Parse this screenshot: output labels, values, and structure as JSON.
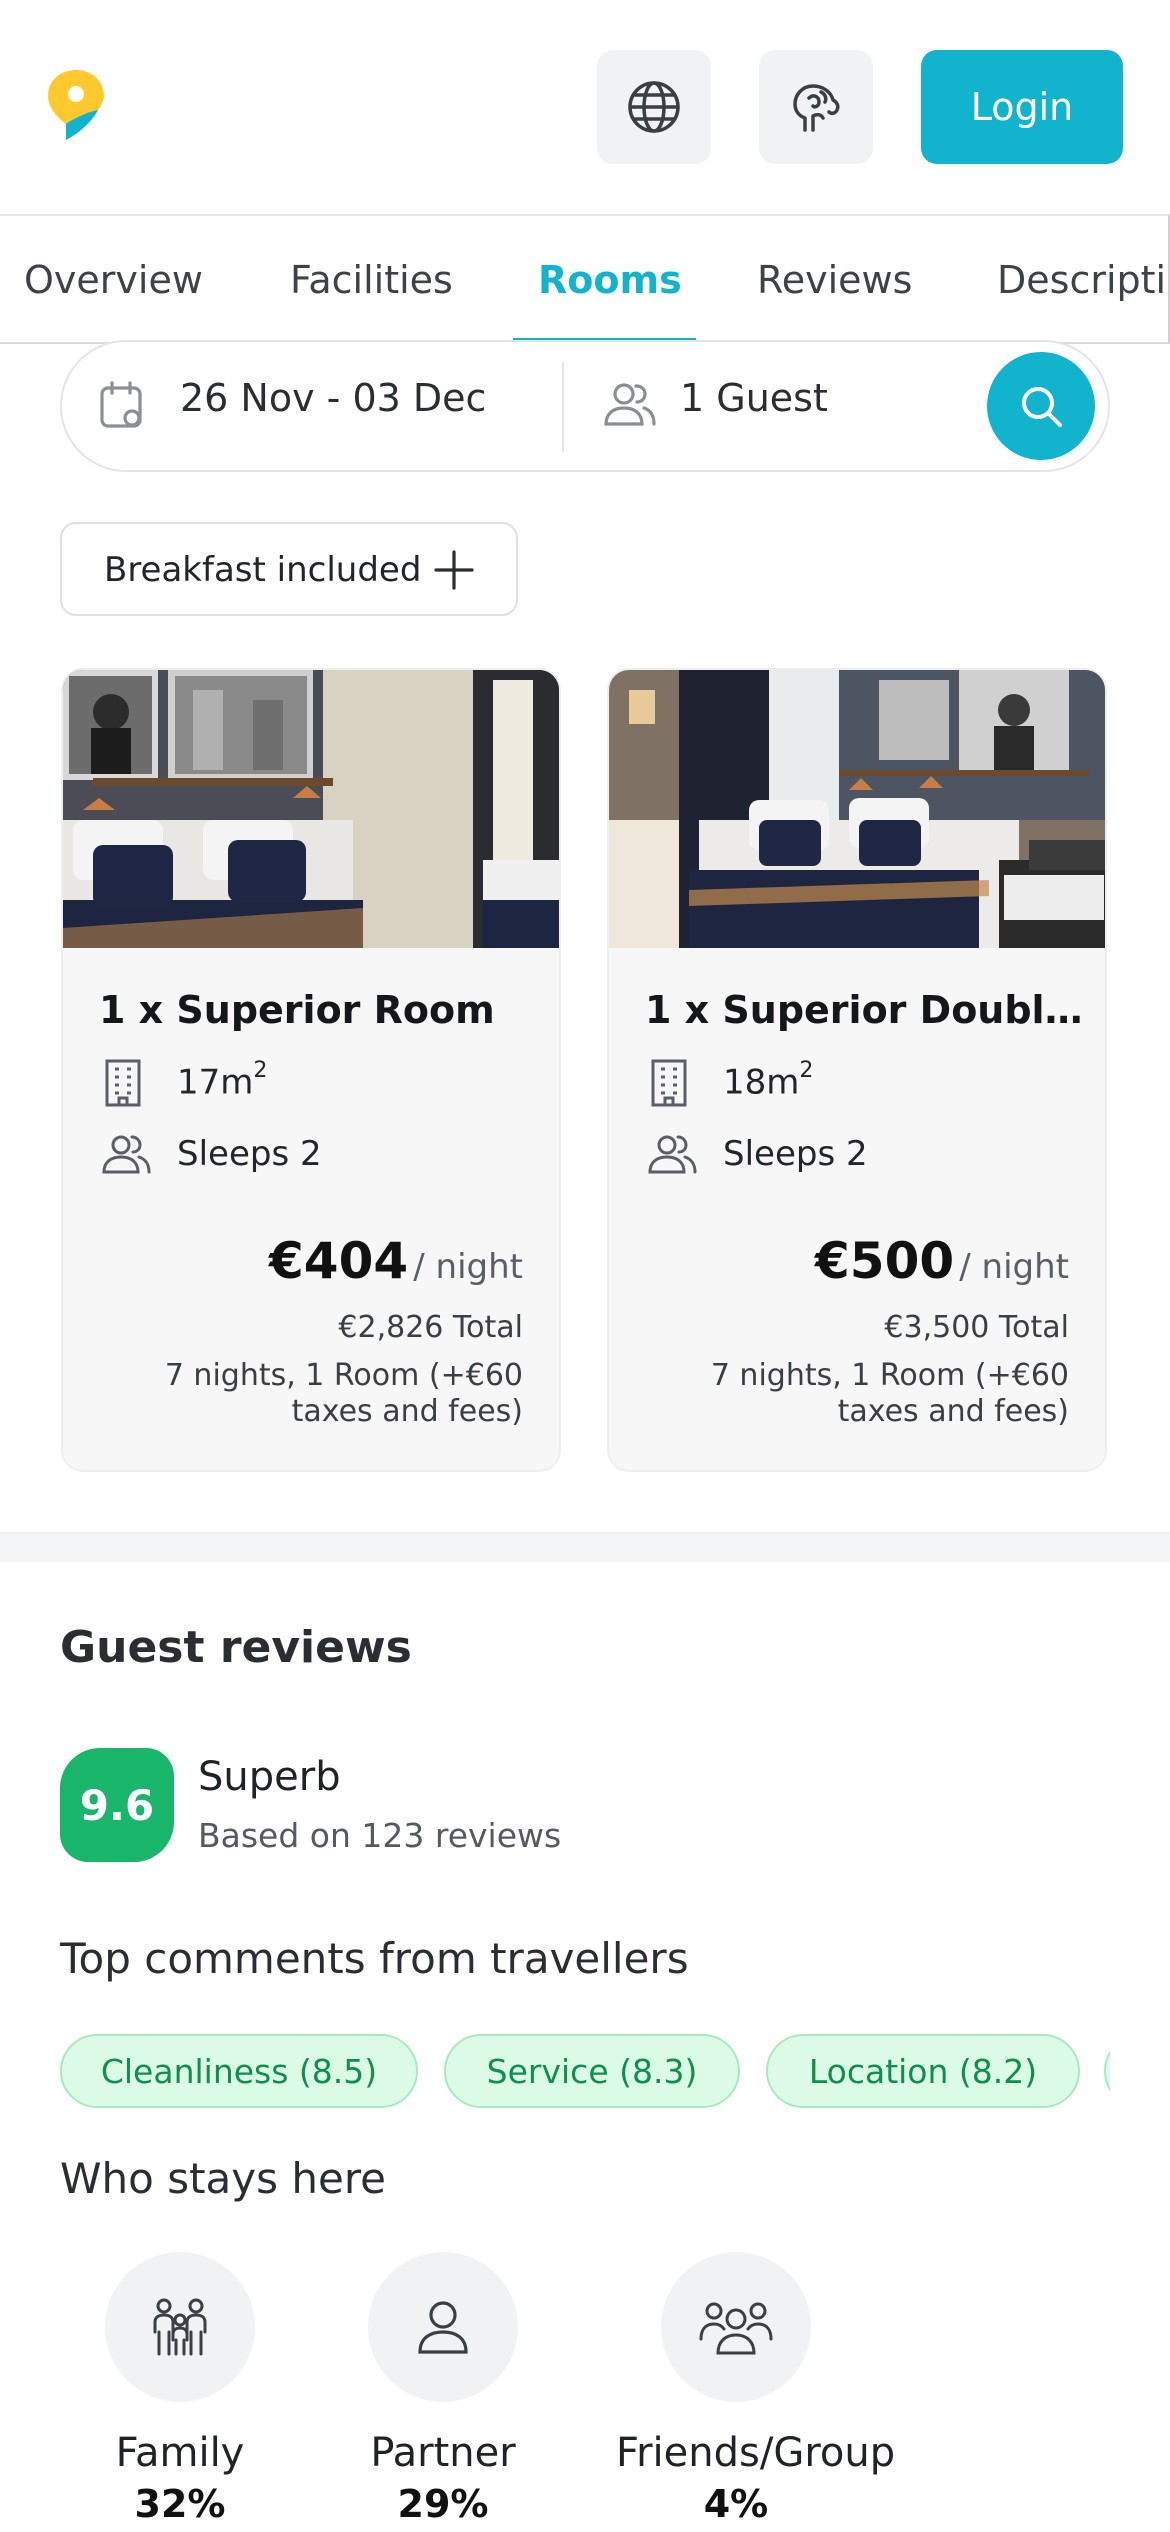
{
  "header": {
    "login_label": "Login",
    "icons": {
      "logo": "map-pin-logo",
      "language": "globe-icon",
      "ai": "brain-icon"
    }
  },
  "tabs": [
    {
      "label": "Overview",
      "active": false
    },
    {
      "label": "Facilities",
      "active": false
    },
    {
      "label": "Rooms",
      "active": true
    },
    {
      "label": "Reviews",
      "active": false
    },
    {
      "label": "Description",
      "active": false
    }
  ],
  "search": {
    "dates": "26 Nov - 03 Dec",
    "guests": "1 Guest"
  },
  "filters": {
    "breakfast_label": "Breakfast included"
  },
  "rooms": [
    {
      "title": "1 x Superior Room",
      "size": "17m",
      "size_sup": "2",
      "sleeps": "Sleeps 2",
      "price": "€404",
      "per": "/ night",
      "total": "€2,826 Total",
      "nights": "7 nights, 1 Room (+€60 taxes and fees)"
    },
    {
      "title": "1 x Superior Doubl...",
      "size": "18m",
      "size_sup": "2",
      "sleeps": "Sleeps 2",
      "price": "€500",
      "per": "/ night",
      "total": "€3,500 Total",
      "nights": "7 nights, 1 Room (+€60 taxes and fees)"
    }
  ],
  "reviews": {
    "title": "Guest reviews",
    "score": "9.6",
    "rating_word": "Superb",
    "rating_count": "Based on 123 reviews",
    "top_comments_title": "Top comments from travellers",
    "tags": [
      "Cleanliness (8.5)",
      "Service (8.3)",
      "Location (8.2)",
      ""
    ],
    "who_title": "Who stays here",
    "who": [
      {
        "label": "Family",
        "pct": "32%",
        "icon": "family-icon"
      },
      {
        "label": "Partner",
        "pct": "29%",
        "icon": "person-icon"
      },
      {
        "label": "Friends/Group",
        "pct": "4%",
        "icon": "group-icon"
      }
    ]
  },
  "colors": {
    "accent": "#12b3cc",
    "score_green": "#18b56b",
    "tag_bg": "#dcfbe6",
    "tag_text": "#0f8f4e"
  }
}
